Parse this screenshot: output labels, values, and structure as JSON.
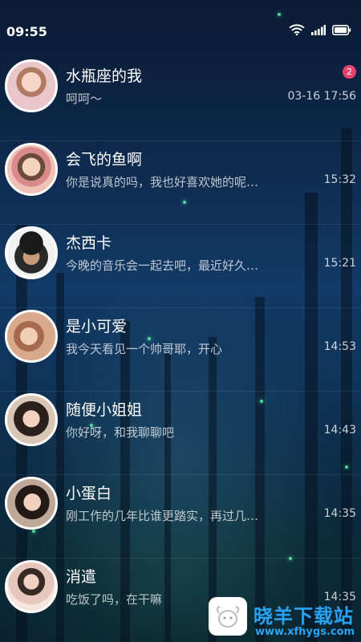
{
  "status_bar": {
    "time": "09:55",
    "icons": [
      "wifi-icon",
      "signal-icon",
      "battery-icon"
    ]
  },
  "colors": {
    "badge": "#e8436f",
    "watermark": "#2aa3f5",
    "avatar_border": "#ffffff"
  },
  "chats": [
    {
      "name": "水瓶座的我",
      "preview": "呵呵～",
      "time": "03-16 17:56",
      "unread": "2"
    },
    {
      "name": "会飞的鱼啊",
      "preview": "你是说真的吗，我也好喜欢她的呢…",
      "time": "15:32"
    },
    {
      "name": "杰西卡",
      "preview": "今晚的音乐会一起去吧，最近好久…",
      "time": "15:21"
    },
    {
      "name": "是小可爱",
      "preview": "我今天看见一个帅哥耶，开心",
      "time": "14:53"
    },
    {
      "name": "随便小姐姐",
      "preview": "你好呀，和我聊聊吧",
      "time": "14:43"
    },
    {
      "name": "小蛋白",
      "preview": "刚工作的几年比谁更踏实，再过几…",
      "time": "14:35"
    },
    {
      "name": "消遣",
      "preview": "吃饭了吗，在干嘛",
      "time": "14:35"
    }
  ],
  "watermark": {
    "title": "晓羊下载站",
    "url": "www.xfhygs.com"
  }
}
